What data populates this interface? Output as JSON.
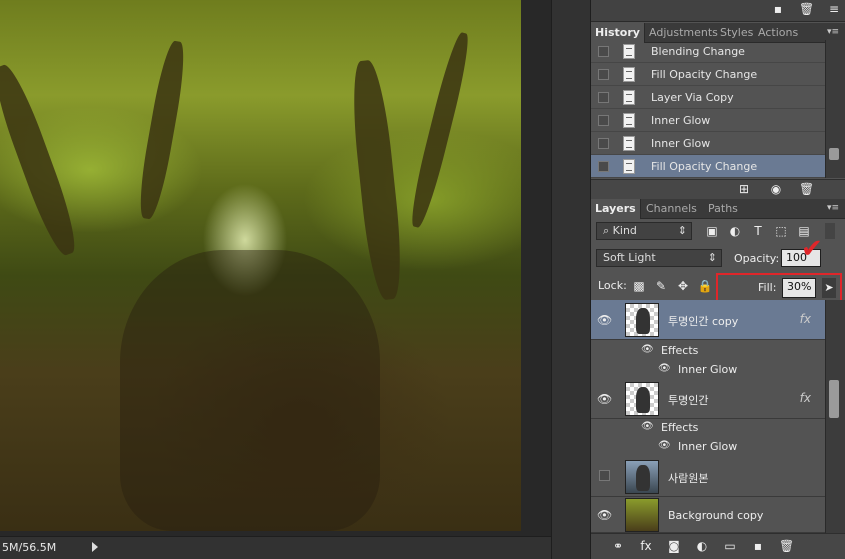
{
  "canvas": {
    "status_text": "5M/56.5M"
  },
  "history_panel": {
    "tabs": [
      "History",
      "Adjustments",
      "Styles",
      "Actions"
    ],
    "items": [
      "Blending Change",
      "Fill Opacity Change",
      "Layer Via Copy",
      "Inner Glow",
      "Inner Glow",
      "Fill Opacity Change"
    ],
    "selected_index": 5
  },
  "layers_panel": {
    "tabs": [
      "Layers",
      "Channels",
      "Paths"
    ],
    "filter_kind": "Kind",
    "blend_mode": "Soft Light",
    "opacity_label": "Opacity:",
    "opacity_value": "100",
    "lock_label": "Lock:",
    "fill_label": "Fill:",
    "fill_value": "30%",
    "fill_slider_fraction": 0.3,
    "layers": [
      {
        "name": "투명인간 copy",
        "fx": "fx",
        "effects_label": "Effects",
        "effect": "Inner Glow",
        "visible": true,
        "selected": true
      },
      {
        "name": "투명인간",
        "fx": "fx",
        "effects_label": "Effects",
        "effect": "Inner Glow",
        "visible": true,
        "selected": false
      },
      {
        "name": "사람원본",
        "visible": false,
        "selected": false
      },
      {
        "name": "Background copy",
        "visible": true,
        "selected": false
      }
    ]
  },
  "colors": {
    "highlight": "#e0262a",
    "selected_row": "#6a7a93",
    "panel_bg": "#535353"
  }
}
